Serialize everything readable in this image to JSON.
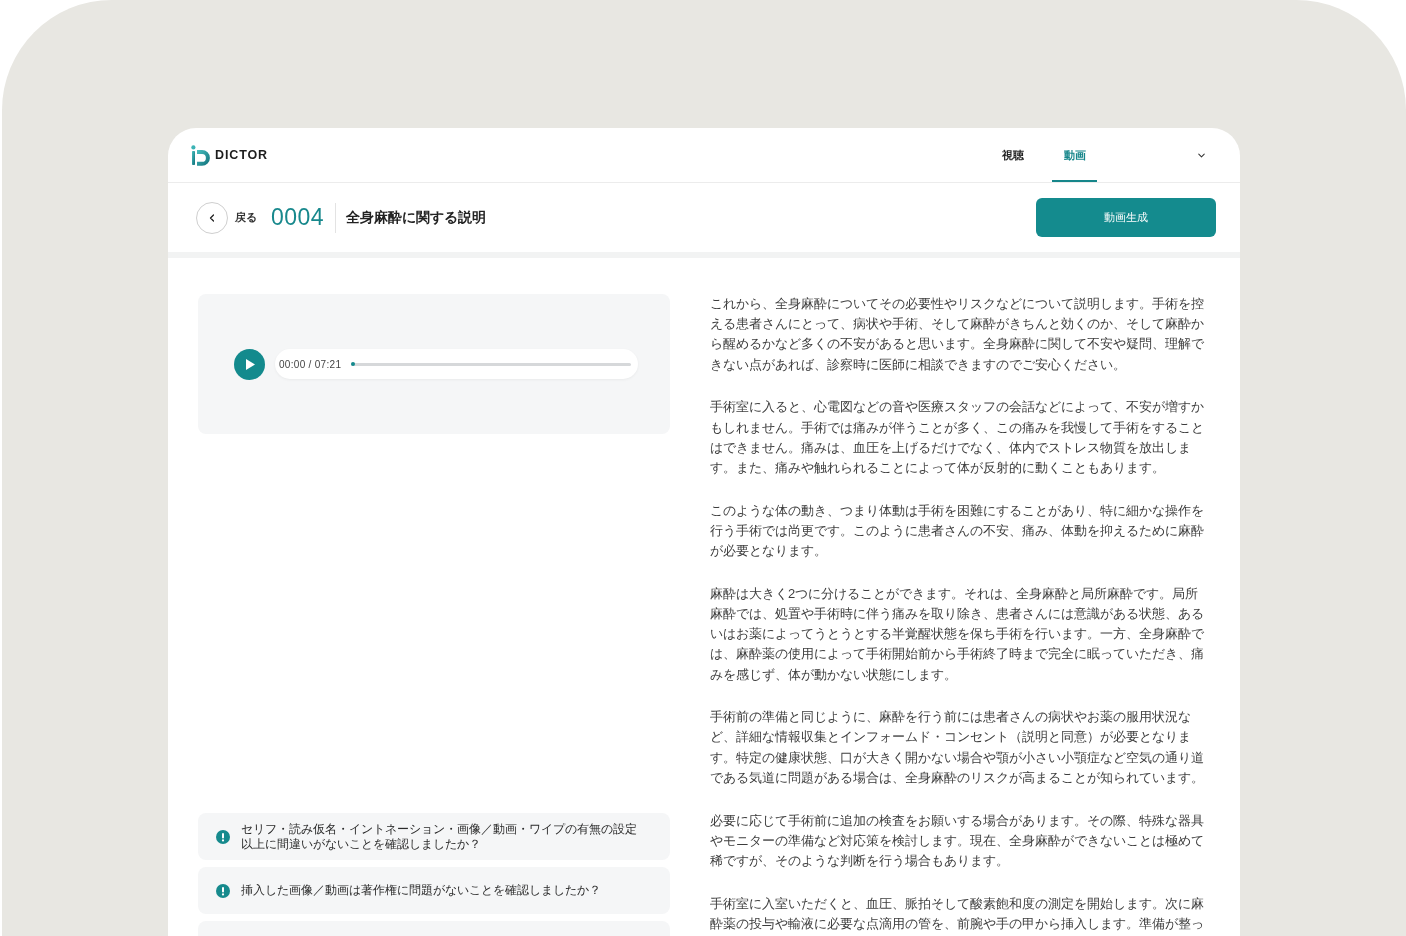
{
  "header": {
    "logo_text": "DICTOR",
    "nav": [
      {
        "label": "視聴",
        "selected": false
      },
      {
        "label": "動画",
        "selected": true
      }
    ]
  },
  "toolbar": {
    "back_label": "戻る",
    "number": "0004",
    "title": "全身麻酔に関する説明",
    "action_button": "動画生成"
  },
  "audio_player": {
    "time": "00:00 / 07:21",
    "level": 0
  },
  "checklist": [
    {
      "kind": "question",
      "lines": [
        "セリフ・読み仮名・イントネーション・画像／動画・ワイプの有無の設定",
        "以上に間違いがないことを確認しましたか？"
      ]
    },
    {
      "kind": "question",
      "lines": [
        "挿入した画像／動画は著作権に問題がないことを確認しましたか？"
      ]
    },
    {
      "kind": "cut_off"
    }
  ],
  "script": {
    "paragraphs": [
      "これから、全身麻酔についてその必要性やリスクなどについて説明します。手術を控える患者さんにとって、病状や手術、そして麻酔がきちんと効くのか、そして麻酔から醒めるかなど多くの不安があると思います。全身麻酔に関して不安や疑問、理解できない点があれば、診察時に医師に相談できますのでご安心ください。",
      "手術室に入ると、心電図などの音や医療スタッフの会話などによって、不安が増すかもしれません。手術では痛みが伴うことが多く、この痛みを我慢して手術をすることはできません。痛みは、血圧を上げるだけでなく、体内でストレス物質を放出します。また、痛みや触れられることによって体が反射的に動くこともあります。",
      "このような体の動き、つまり体動は手術を困難にすることがあり、特に細かな操作を行う手術では尚更です。このように患者さんの不安、痛み、体動を抑えるために麻酔が必要となります。",
      "麻酔は大きく2つに分けることができます。それは、全身麻酔と局所麻酔です。局所麻酔では、処置や手術時に伴う痛みを取り除き、患者さんには意識がある状態、あるいはお薬によってうとうとする半覚醒状態を保ち手術を行います。一方、全身麻酔では、麻酔薬の使用によって手術開始前から手術終了時まで完全に眠っていただき、痛みを感じず、体が動かない状態にします。",
      "手術前の準備と同じように、麻酔を行う前には患者さんの病状やお薬の服用状況など、詳細な情報収集とインフォームド・コンセント（説明と同意）が必要となります。特定の健康状態、口が大きく開かない場合や顎が小さい小顎症など空気の通り道である気道に問題がある場合は、全身麻酔のリスクが高まることが知られています。",
      "必要に応じて手術前に追加の検査をお願いする場合があります。その際、特殊な器具やモニターの準備など対応策を検討します。現在、全身麻酔ができないことは極めて稀ですが、そのような判断を行う場合もあります。",
      "手術室に入室いただくと、血圧、脈拍そして酸素飽和度の測定を開始します。次に麻酔薬の投与や輸液に必要な点滴用の管を、前腕や手の甲から挿入します。準備が整っ"
    ]
  }
}
